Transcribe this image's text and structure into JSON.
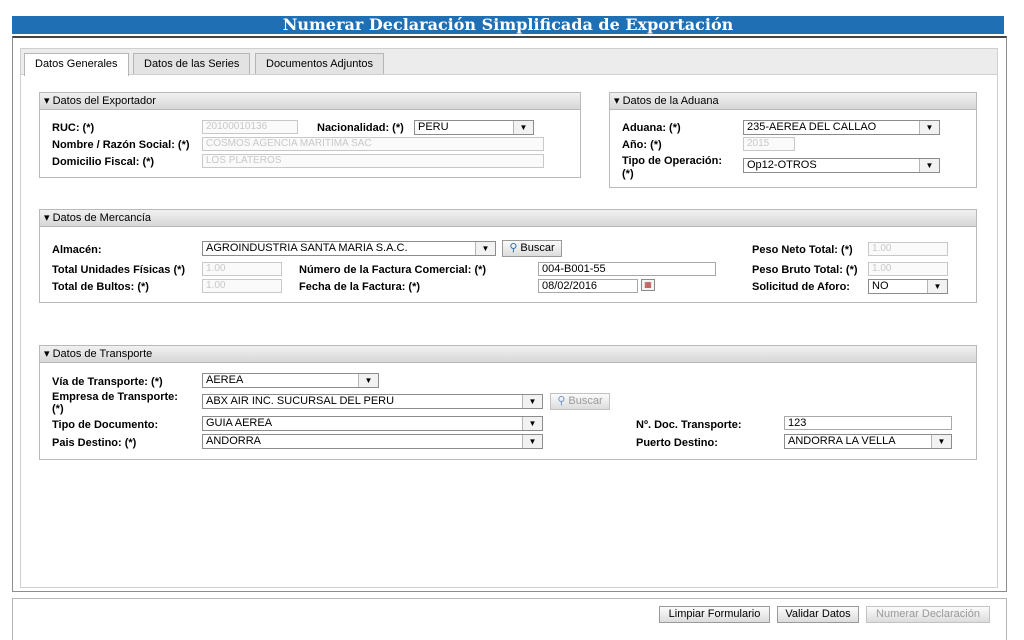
{
  "title": "Numerar Declaración Simplificada de Exportación",
  "tabs": [
    {
      "label": "Datos Generales"
    },
    {
      "label": "Datos de las Series"
    },
    {
      "label": "Documentos Adjuntos"
    }
  ],
  "exportador": {
    "header": "Datos del Exportador",
    "ruc_label": "RUC: (*)",
    "ruc_value": "20100010136",
    "nacionalidad_label": "Nacionalidad: (*)",
    "nacionalidad_value": "PERU",
    "razon_label": "Nombre / Razón Social: (*)",
    "razon_value": "COSMOS AGENCIA MARITIMA SAC",
    "domicilio_label": "Domicilio Fiscal: (*)",
    "domicilio_value": "LOS PLATEROS"
  },
  "aduana": {
    "header": "Datos de la Aduana",
    "aduana_label": "Aduana: (*)",
    "aduana_value": "235-AEREA DEL CALLAO",
    "anio_label": "Año: (*)",
    "anio_value": "2015",
    "operacion_label_1": "Tipo de Operación:",
    "operacion_label_2": "(*)",
    "operacion_value": "Op12-OTROS"
  },
  "mercancia": {
    "header": "Datos de Mercancía",
    "almacen_label": "Almacén:",
    "almacen_value": "AGROINDUSTRIA SANTA MARIA S.A.C.",
    "buscar_label": "Buscar",
    "peso_neto_label": "Peso Neto Total: (*)",
    "peso_neto_value": "1.00",
    "unidades_label": "Total Unidades Físicas (*)",
    "unidades_value": "1.00",
    "factura_label": "Número de la Factura Comercial: (*)",
    "factura_value": "004-B001-55",
    "peso_bruto_label": "Peso Bruto Total: (*)",
    "peso_bruto_value": "1.00",
    "bultos_label": "Total de Bultos: (*)",
    "bultos_value": "1.00",
    "fecha_label": "Fecha de la Factura: (*)",
    "fecha_value": "08/02/2016",
    "aforo_label": "Solicitud de Aforo:",
    "aforo_value": "NO"
  },
  "transporte": {
    "header": "Datos de Transporte",
    "via_label": "Vía de Transporte: (*)",
    "via_value": "AEREA",
    "empresa_label_1": "Empresa de Transporte:",
    "empresa_label_2": "(*)",
    "empresa_value": "ABX AIR INC. SUCURSAL DEL PERU",
    "buscar_label": "Buscar",
    "tipo_doc_label": "Tipo de Documento:",
    "tipo_doc_value": "GUIA AEREA",
    "nro_doc_label": "Nº. Doc. Transporte:",
    "nro_doc_value": "123",
    "pais_label": "Pais Destino: (*)",
    "pais_value": "ANDORRA",
    "puerto_label": "Puerto Destino:",
    "puerto_value": "ANDORRA LA VELLA"
  },
  "footer": {
    "limpiar": "Limpiar Formulario",
    "validar": "Validar Datos",
    "numerar": "Numerar Declaración"
  },
  "icons": {
    "collapse": "triangle-down-icon",
    "dropdown": "chevron-down-icon",
    "search": "magnifier-icon",
    "calendar": "calendar-icon"
  }
}
